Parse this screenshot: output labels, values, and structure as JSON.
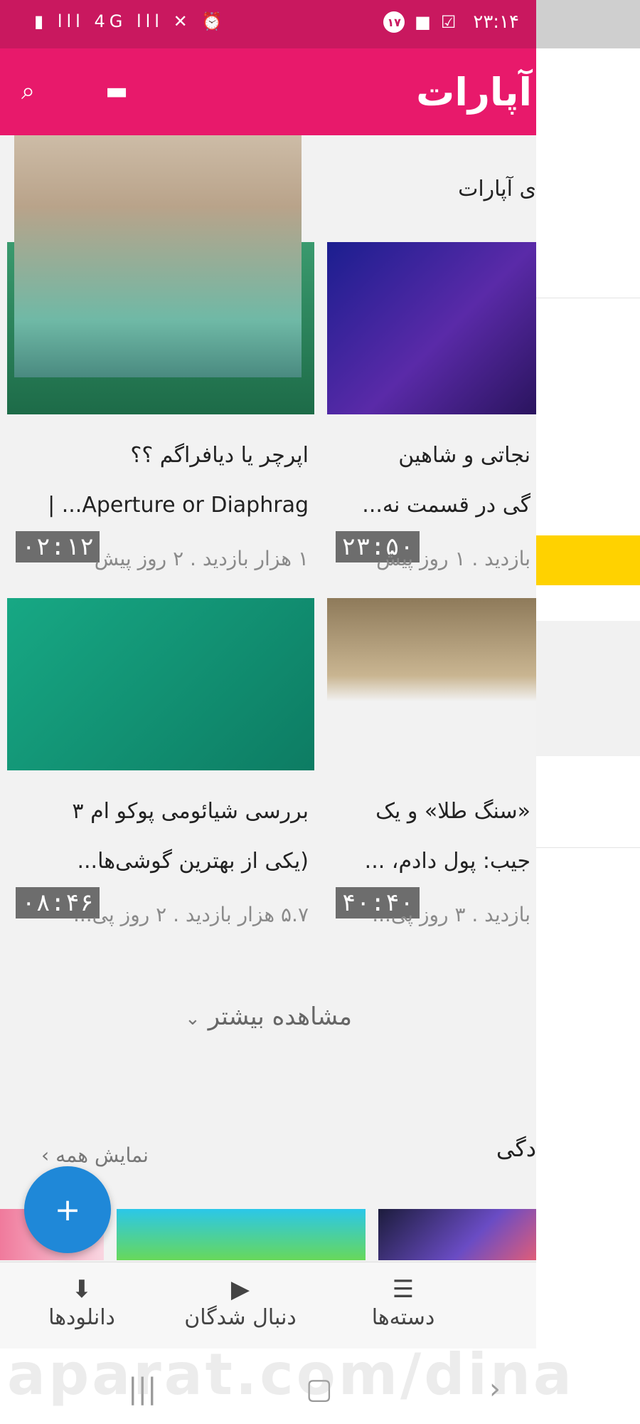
{
  "status_bar": {
    "left_icons": "▮ lll 4G lll ✕ ⏰",
    "notification_count": "۱۷",
    "time": "۲۳:۱۴"
  },
  "header": {
    "logo": "آپارات"
  },
  "section1": {
    "title_partial": "ی آپارات"
  },
  "videos": [
    {
      "title_line1": "اپرچر یا دیافراگم ؟؟",
      "title_line2": "Aperture or Diaphrag... |",
      "meta": "۱ هزار بازدید . ۲ روز پیش",
      "duration": "۰۲:۱۲"
    },
    {
      "title_line1": "نجاتی و شاهین",
      "title_line2": "گی در قسمت نه...",
      "meta": "بازدید . ۱ روز پیش",
      "duration": "۲۳:۵۰"
    },
    {
      "title_line1": "بررسی شیائومی پوکو ام ۳",
      "title_line2": "(یکی از بهترین گوشی‌ها...",
      "meta": "۵.۷ هزار بازدید . ۲ روز پی...",
      "duration": "۰۸:۴۶"
    },
    {
      "title_line1": "«سنگ طلا» و یک",
      "title_line2": "جیب: پول دادم، ...",
      "meta": "بازدید . ۳ روز پی...",
      "duration": "۴۰:۴۰"
    }
  ],
  "more_label": "مشاهده بیشتر",
  "section2": {
    "title_partial": "دگی",
    "show_all": "نمایش همه"
  },
  "fab_icon": "+",
  "bottom_nav": [
    {
      "label": "دانلودها",
      "icon": "download-icon"
    },
    {
      "label": "دنبال شدگان",
      "icon": "subscriptions-icon"
    },
    {
      "label": "دسته‌ها",
      "icon": "list-icon"
    }
  ],
  "watermark": "aparat.com/dina"
}
